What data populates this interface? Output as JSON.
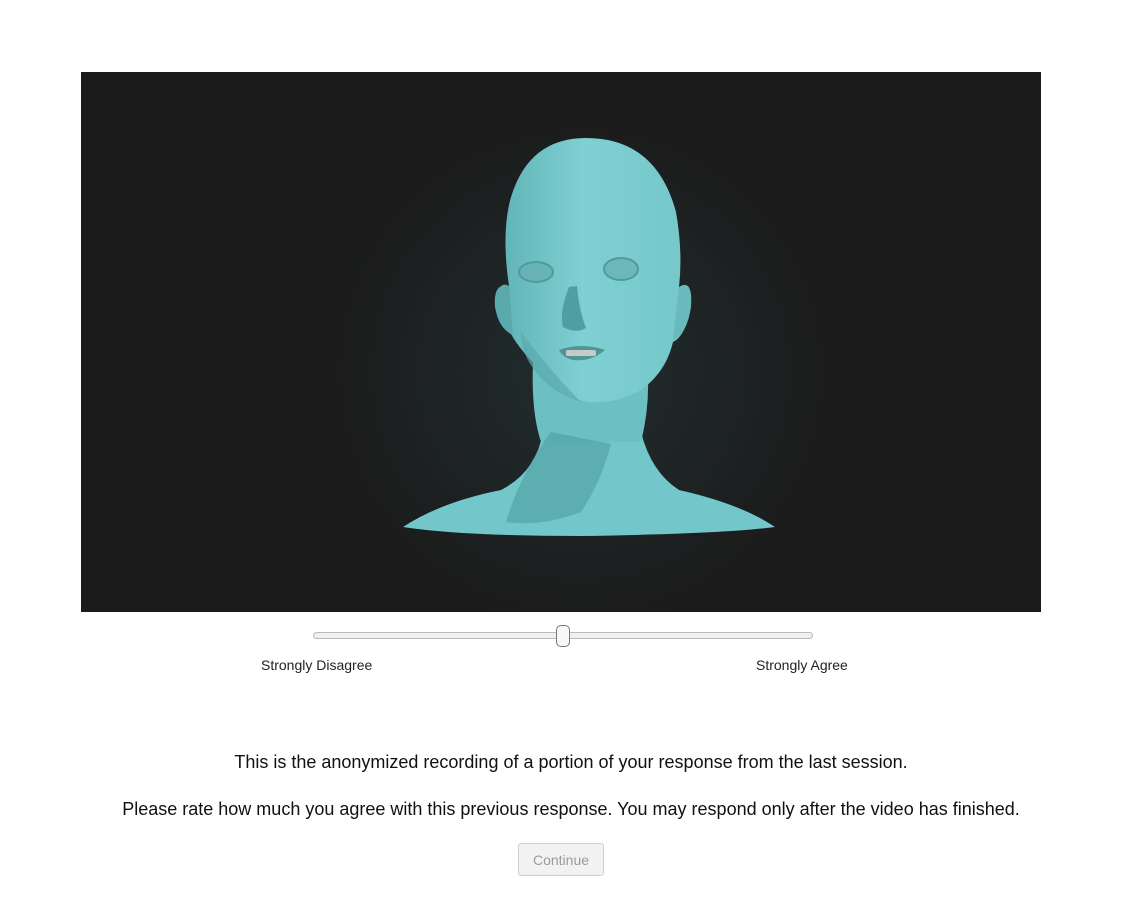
{
  "video": {
    "background_color": "#1b1b1b",
    "subject_color": "#79c9cc",
    "subject": "3d-head-avatar"
  },
  "rating_slider": {
    "value_fraction": 0.5,
    "min_label": "Strongly Disagree",
    "max_label": "Strongly Agree"
  },
  "instructions": {
    "line1": "This is the anonymized recording of a portion of your response from the last session.",
    "line2": "Please rate how much you agree with this previous response. You may respond only after the video has finished."
  },
  "continue_button": {
    "label": "Continue",
    "disabled": true
  }
}
